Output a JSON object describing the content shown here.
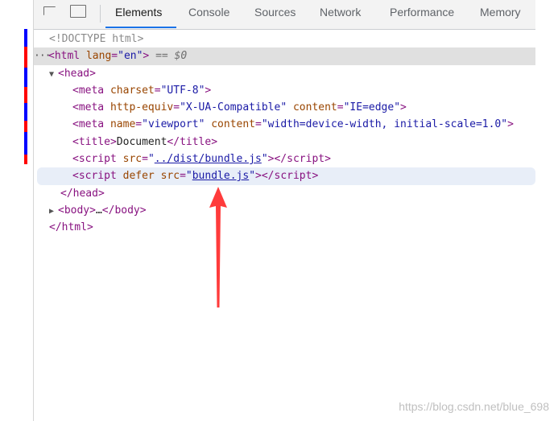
{
  "tabs": [
    {
      "label": "Elements"
    },
    {
      "label": "Console"
    },
    {
      "label": "Sources"
    },
    {
      "label": "Network"
    },
    {
      "label": "Performance"
    },
    {
      "label": "Memory"
    }
  ],
  "dom": {
    "doctype": "<!DOCTYPE html>",
    "html_open": {
      "tag": "html",
      "attr": "lang",
      "value": "en",
      "suffix": "== $0"
    },
    "head_open": "head",
    "meta_charset": {
      "attr": "charset",
      "value": "UTF-8"
    },
    "meta_compat": {
      "attr1": "http-equiv",
      "value1": "X-UA-Compatible",
      "attr2": "content",
      "value2": "IE=edge"
    },
    "meta_viewport": {
      "attr1": "name",
      "value1": "viewport",
      "attr2": "content",
      "value2": "width=device-width, initial-scale=1.0"
    },
    "title": {
      "tag": "title",
      "text": "Document"
    },
    "script_bundle": {
      "tag": "script",
      "attr": "src",
      "value": "../dist/bundle.js"
    },
    "script_defer": {
      "tag": "script",
      "keyword": "defer",
      "attr": "src",
      "value": "bundle.js"
    },
    "head_close": "head",
    "body": {
      "tag": "body",
      "ellipsis": "…"
    },
    "html_close": "html"
  },
  "watermark": "https://blog.csdn.net/blue_698",
  "colors": {
    "arrow": "#ff3b3b",
    "stripe_red": "#ff0000",
    "stripe_blue": "#0000ff"
  }
}
